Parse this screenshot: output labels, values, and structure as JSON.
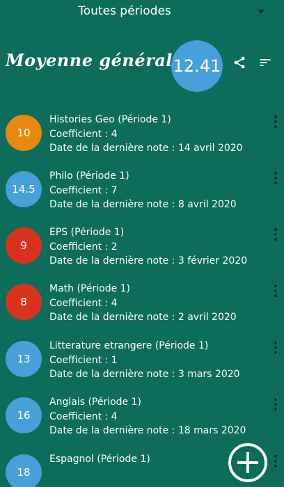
{
  "period": {
    "label": "Toutes périodes"
  },
  "header": {
    "title": "Moyenne générale :",
    "average": "12.41"
  },
  "colors": {
    "background": "#0d6d5a",
    "orange": "#e8880f",
    "blue": "#47a0d9",
    "red": "#d93320"
  },
  "subjects": [
    {
      "grade": "10",
      "color": "#e8880f",
      "name": "Histories Geo (Période 1)",
      "coefficient": "Coefficient : 4",
      "last_note": "Date de la dernière note : 14 avril 2020"
    },
    {
      "grade": "14.5",
      "color": "#47a0d9",
      "name": "Philo (Période 1)",
      "coefficient": "Coefficient : 7",
      "last_note": "Date de la dernière note : 8 avril 2020"
    },
    {
      "grade": "9",
      "color": "#d93320",
      "name": "EPS (Période 1)",
      "coefficient": "Coefficient : 2",
      "last_note": "Date de la dernière note : 3 février 2020"
    },
    {
      "grade": "8",
      "color": "#d93320",
      "name": "Math (Période 1)",
      "coefficient": "Coefficient : 4",
      "last_note": "Date de la dernière note : 2 avril 2020"
    },
    {
      "grade": "13",
      "color": "#47a0d9",
      "name": "Litterature etrangere (Période 1)",
      "coefficient": "Coefficient : 1",
      "last_note": "Date de la dernière note : 3 mars 2020"
    },
    {
      "grade": "16",
      "color": "#47a0d9",
      "name": "Anglais (Période 1)",
      "coefficient": "Coefficient : 4",
      "last_note": "Date de la dernière note : 18 mars 2020"
    },
    {
      "grade": "18",
      "color": "#47a0d9",
      "name": "Espagnol (Période 1)",
      "coefficient": "",
      "last_note": ""
    }
  ],
  "icons": {
    "share": "share-icon",
    "sort": "sort-icon",
    "more": "more-vert-icon",
    "add": "add-circle-icon",
    "caret": "dropdown-caret-icon"
  }
}
